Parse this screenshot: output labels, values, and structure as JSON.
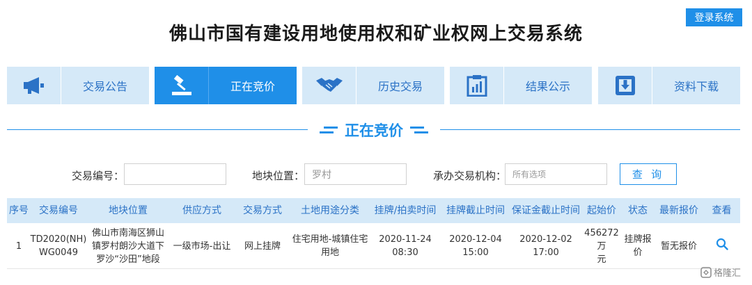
{
  "header": {
    "login_label": "登录系统",
    "title": "佛山市国有建设用地使用权和矿业权网上交易系统"
  },
  "nav": {
    "items": [
      {
        "label": "交易公告",
        "icon": "megaphone-icon"
      },
      {
        "label": "正在竞价",
        "icon": "gavel-icon"
      },
      {
        "label": "历史交易",
        "icon": "handshake-icon"
      },
      {
        "label": "结果公示",
        "icon": "clipboard-chart-icon"
      },
      {
        "label": "资料下载",
        "icon": "download-icon"
      }
    ],
    "active_index": 1
  },
  "section": {
    "title": "正在竞价"
  },
  "filters": {
    "trade_no_label": "交易编号：",
    "trade_no_value": "",
    "location_label": "地块位置：",
    "location_value": "罗村",
    "agency_label": "承办交易机构：",
    "agency_placeholder": "所有选项",
    "search_label": "查 询"
  },
  "table": {
    "headers": [
      "序号",
      "交易编号",
      "地块位置",
      "供应方式",
      "交易方式",
      "土地用途分类",
      "挂牌/拍卖时间",
      "挂牌截止时间",
      "保证金截止时间",
      "起始价",
      "状态",
      "最新报价",
      "查看"
    ],
    "rows": [
      {
        "index": "1",
        "trade_no_1": "TD2020(NH)",
        "trade_no_2": "WG0049",
        "location_1": "佛山市南海区狮山",
        "location_2": "镇罗村朗沙大道下",
        "location_3": "罗沙“沙田”地段",
        "supply": "一级市场-出让",
        "trade_method": "网上挂牌",
        "use_1": "住宅用地-城镇住宅",
        "use_2": "用地",
        "listing_date": "2020-11-24",
        "listing_time": "08:30",
        "deadline_date": "2020-12-04",
        "deadline_time": "15:00",
        "deposit_date": "2020-12-02",
        "deposit_time": "17:00",
        "start_price_1": "456272万",
        "start_price_2": "元",
        "status": "挂牌报价",
        "latest_quote": "暂无报价"
      }
    ]
  },
  "watermark": "格隆汇",
  "colors": {
    "accent": "#1f8fe8",
    "nav_bg": "#d5e9f8",
    "nav_text": "#2b72c6"
  }
}
